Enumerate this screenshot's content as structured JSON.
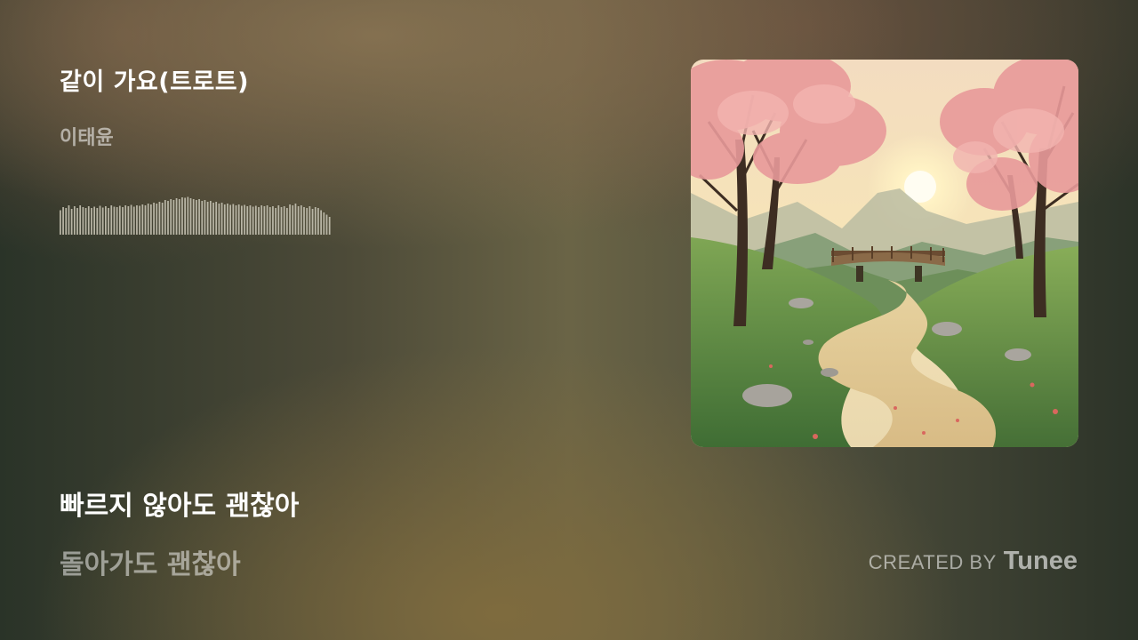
{
  "song": {
    "title": "같이 가요(트로트)",
    "artist": "이태윤"
  },
  "lyrics": {
    "current": "빠르지 않아도 괜찮아",
    "next": "돌아가도 괜찮아"
  },
  "credit": {
    "prefix": "CREATED BY",
    "brand": "Tunee"
  },
  "cover_art": {
    "description_icon": "album-cover-image"
  },
  "waveform": {
    "bar_color": "#b9b6a6",
    "bar_count": 96,
    "levels": [
      0.55,
      0.62,
      0.6,
      0.66,
      0.58,
      0.64,
      0.6,
      0.66,
      0.62,
      0.6,
      0.64,
      0.6,
      0.63,
      0.6,
      0.65,
      0.61,
      0.64,
      0.6,
      0.66,
      0.63,
      0.62,
      0.65,
      0.62,
      0.66,
      0.64,
      0.67,
      0.63,
      0.66,
      0.65,
      0.68,
      0.66,
      0.7,
      0.68,
      0.72,
      0.7,
      0.74,
      0.72,
      0.78,
      0.76,
      0.8,
      0.78,
      0.82,
      0.8,
      0.84,
      0.83,
      0.85,
      0.82,
      0.8,
      0.78,
      0.8,
      0.76,
      0.78,
      0.74,
      0.76,
      0.72,
      0.74,
      0.7,
      0.72,
      0.68,
      0.7,
      0.67,
      0.69,
      0.66,
      0.68,
      0.65,
      0.67,
      0.64,
      0.66,
      0.63,
      0.65,
      0.62,
      0.66,
      0.64,
      0.66,
      0.62,
      0.64,
      0.6,
      0.66,
      0.62,
      0.64,
      0.6,
      0.68,
      0.66,
      0.7,
      0.64,
      0.66,
      0.62,
      0.6,
      0.64,
      0.58,
      0.62,
      0.6,
      0.55,
      0.5,
      0.45,
      0.4
    ]
  }
}
